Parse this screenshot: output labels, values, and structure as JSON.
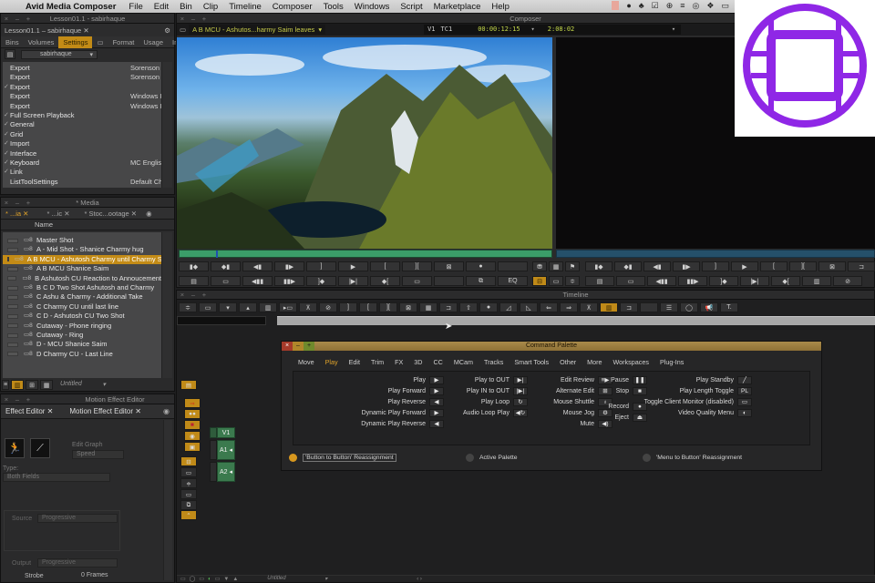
{
  "menubar": {
    "app_name": "Avid Media Composer",
    "items": [
      "File",
      "Edit",
      "Bin",
      "Clip",
      "Timeline",
      "Composer",
      "Tools",
      "Windows",
      "Script",
      "Marketplace",
      "Help"
    ]
  },
  "project_window": {
    "title": "Lesson01.1 - sabirhaque",
    "tab_label": "Lesson01.1 – sabirhaque",
    "tabs": [
      "Bins",
      "Volumes",
      "Settings",
      "Format",
      "Usage",
      "Info"
    ],
    "active_tab": "Settings",
    "user_dropdown": "sabirhaque",
    "settings": [
      {
        "checked": false,
        "name": "Export",
        "value": "Sorenson S"
      },
      {
        "checked": false,
        "name": "Export",
        "value": "Sorenson S"
      },
      {
        "checked": true,
        "name": "Export",
        "value": ""
      },
      {
        "checked": false,
        "name": "Export",
        "value": "Windows In"
      },
      {
        "checked": false,
        "name": "Export",
        "value": "Windows In"
      },
      {
        "checked": true,
        "name": "Full Screen Playback",
        "value": ""
      },
      {
        "checked": true,
        "name": "General",
        "value": ""
      },
      {
        "checked": true,
        "name": "Grid",
        "value": ""
      },
      {
        "checked": true,
        "name": "Import",
        "value": ""
      },
      {
        "checked": true,
        "name": "Interface",
        "value": ""
      },
      {
        "checked": true,
        "name": "Keyboard",
        "value": "MC English"
      },
      {
        "checked": true,
        "name": "Link",
        "value": ""
      },
      {
        "checked": false,
        "name": "ListToolSettings",
        "value": "Default Cha"
      }
    ]
  },
  "bin_window": {
    "title": "* Media",
    "tabs": [
      "* ...ia",
      "* ...ic",
      "* Stoc...ootage"
    ],
    "column_header": "Name",
    "clips": [
      {
        "name": "Master Shot",
        "selected": false
      },
      {
        "name": "A - Mid Shot - Shanice Charmy hug",
        "selected": false
      },
      {
        "name": "A B MCU - Ashutosh Charmy until Charmy S",
        "selected": true
      },
      {
        "name": "A B MCU Shanice Saim",
        "selected": false
      },
      {
        "name": "B Ashutosh CU Reaction to Annoucement",
        "selected": false
      },
      {
        "name": "B C D Two Shot Ashutosh and Charmy",
        "selected": false
      },
      {
        "name": "C  Ashu & Charmy - Additional Take",
        "selected": false
      },
      {
        "name": "C Charmy CU until last line",
        "selected": false
      },
      {
        "name": "C D - Ashutosh CU Two Shot",
        "selected": false
      },
      {
        "name": "Cutaway - Phone ringing",
        "selected": false
      },
      {
        "name": "Cutaway - Ring",
        "selected": false
      },
      {
        "name": "D - MCU Shanice Saim",
        "selected": false
      },
      {
        "name": "D Charmy CU - Last Line",
        "selected": false
      }
    ],
    "view_dropdown": "Untitled"
  },
  "motion_effect": {
    "title": "Motion Effect Editor",
    "tabs": [
      "Effect Editor",
      "Motion Effect Editor"
    ],
    "edit_graph_label": "Edit Graph",
    "edit_graph_value": "Speed",
    "type_label": "Type:",
    "type_value": "Both Fields",
    "source_label": "Source",
    "source_value": "Progressive",
    "output_label": "Output",
    "output_value": "Progressive",
    "strobe_label": "Strobe",
    "strobe_value": "0 Frames"
  },
  "composer": {
    "title": "Composer",
    "clip_name": "A B MCU - Ashutos...harmy Saim leaves",
    "track": "V1",
    "tc_label": "TC1",
    "timecode": "00:00:12:15",
    "duration": "2:08:02"
  },
  "timeline": {
    "title": "Timeline",
    "tracks": [
      "V1",
      "A1",
      "A2"
    ],
    "sequence_dropdown": "Untitled"
  },
  "command_palette": {
    "title": "Command Palette",
    "tabs": [
      "Move",
      "Play",
      "Edit",
      "Trim",
      "FX",
      "3D",
      "CC",
      "MCam",
      "Tracks",
      "Smart Tools",
      "Other",
      "More",
      "Workspaces",
      "Plug-Ins"
    ],
    "active_tab": "Play",
    "col1": [
      {
        "label": "Play",
        "icon": "▶"
      },
      {
        "label": "Play Forward",
        "icon": "▶"
      },
      {
        "label": "Play Reverse",
        "icon": "◀"
      },
      {
        "label": "Dynamic Play Forward",
        "icon": "▶"
      },
      {
        "label": "Dynamic Play Reverse",
        "icon": "◀"
      }
    ],
    "col2": [
      {
        "label": "Play to OUT",
        "icon": "▶|"
      },
      {
        "label": "Play IN to OUT",
        "icon": "|▶|"
      },
      {
        "label": "Play Loop",
        "icon": "↻"
      },
      {
        "label": "Audio Loop Play",
        "icon": "◀↻"
      }
    ],
    "col3": [
      {
        "label": "Edit Review",
        "icon": "≡▶"
      },
      {
        "label": "Alternate Edit",
        "icon": "⊞"
      },
      {
        "label": "Mouse Shuttle",
        "icon": "♁"
      },
      {
        "label": "Mouse Jog",
        "icon": "⚙"
      },
      {
        "label": "Mute",
        "icon": "◀)"
      }
    ],
    "col4": [
      {
        "label": "Pause",
        "icon": "❚❚"
      },
      {
        "label": "Stop",
        "icon": "■"
      },
      {
        "label": "Record",
        "icon": "●"
      },
      {
        "label": "Eject",
        "icon": "⏏"
      }
    ],
    "col5": [
      {
        "label": "Play Standby",
        "icon": "╱"
      },
      {
        "label": "Play Length Toggle",
        "icon": "PL"
      },
      {
        "label": "Toggle Client Monitor (disabled)",
        "icon": "▭"
      },
      {
        "label": "Video Quality Menu",
        "icon": "◐"
      }
    ],
    "radios": [
      {
        "label": "'Button to Button' Reassignment",
        "selected": true
      },
      {
        "label": "Active Palette",
        "selected": false
      },
      {
        "label": "'Menu to Button' Reassignment",
        "selected": false
      }
    ]
  },
  "colors": {
    "accent": "#c38b16",
    "logo": "#8f27e6",
    "track_green": "#3b7a4e"
  }
}
